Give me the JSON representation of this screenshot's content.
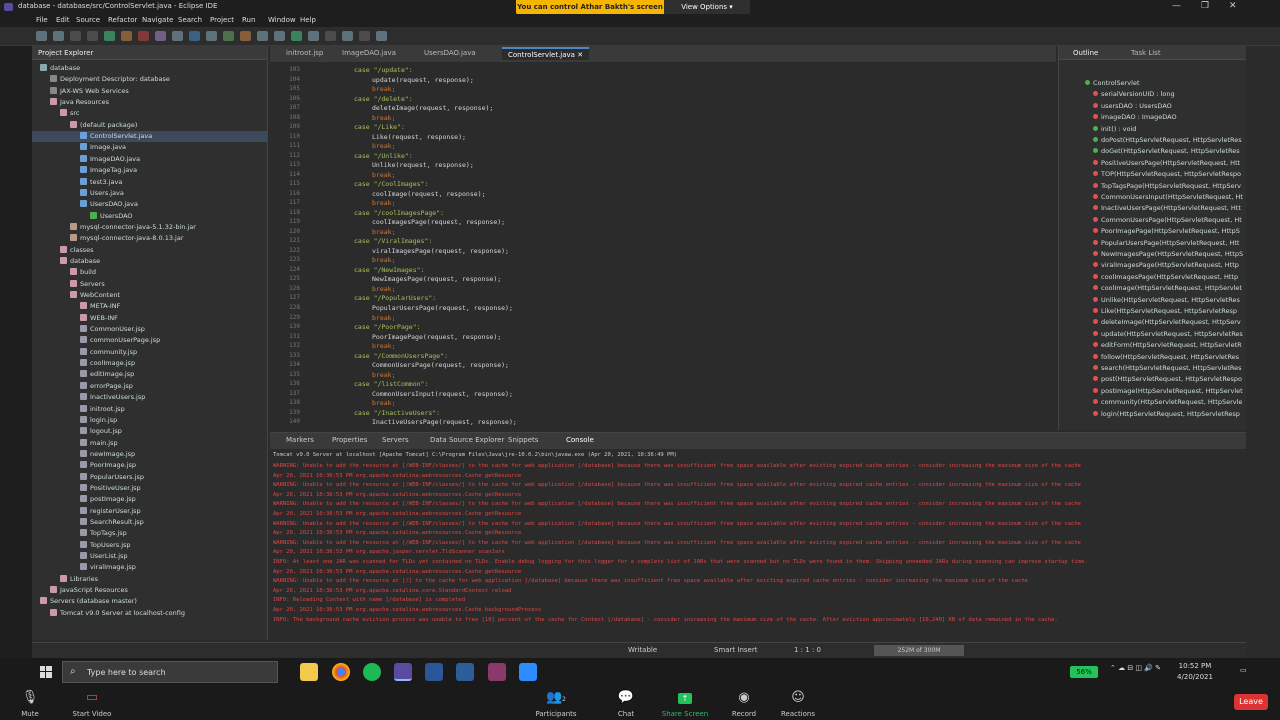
{
  "window": {
    "title": "database - database/src/ControlServlet.java - Eclipse IDE"
  },
  "share_banner": {
    "text": "You can control Athar Bakth's screen",
    "view_options": "View Options"
  },
  "menu": [
    "File",
    "Edit",
    "Source",
    "Refactor",
    "Navigate",
    "Search",
    "Project",
    "Run",
    "Window",
    "Help"
  ],
  "explorer": {
    "title": "Project Explorer",
    "tree": [
      {
        "label": "database",
        "indent": 0,
        "color": "#8aa"
      },
      {
        "label": "Deployment Descriptor: database",
        "indent": 1,
        "color": "#888"
      },
      {
        "label": "JAX-WS Web Services",
        "indent": 1,
        "color": "#888"
      },
      {
        "label": "Java Resources",
        "indent": 1,
        "color": "#c9a"
      },
      {
        "label": "src",
        "indent": 2,
        "color": "#c9a"
      },
      {
        "label": "(default package)",
        "indent": 3,
        "color": "#c9a"
      },
      {
        "label": "ControlServlet.java",
        "indent": 4,
        "color": "#6a9fd8",
        "selected": true
      },
      {
        "label": "Image.java",
        "indent": 4,
        "color": "#6a9fd8"
      },
      {
        "label": "ImageDAO.java",
        "indent": 4,
        "color": "#6a9fd8"
      },
      {
        "label": "ImageTag.java",
        "indent": 4,
        "color": "#6a9fd8"
      },
      {
        "label": "test3.java",
        "indent": 4,
        "color": "#6a9fd8"
      },
      {
        "label": "Users.java",
        "indent": 4,
        "color": "#6a9fd8"
      },
      {
        "label": "UsersDAO.java",
        "indent": 4,
        "color": "#6a9fd8"
      },
      {
        "label": "UsersDAO",
        "indent": 5,
        "color": "#4caf50"
      },
      {
        "label": "mysql-connector-java-5.1.32-bin.jar",
        "indent": 3,
        "color": "#b98"
      },
      {
        "label": "mysql-connector-java-8.0.13.jar",
        "indent": 3,
        "color": "#b98"
      },
      {
        "label": "classes",
        "indent": 2,
        "color": "#c9a"
      },
      {
        "label": "database",
        "indent": 2,
        "color": "#c9a"
      },
      {
        "label": "build",
        "indent": 3,
        "color": "#c9a"
      },
      {
        "label": "Servers",
        "indent": 3,
        "color": "#c9a"
      },
      {
        "label": "WebContent",
        "indent": 3,
        "color": "#c9a"
      },
      {
        "label": "META-INF",
        "indent": 4,
        "color": "#c9a"
      },
      {
        "label": "WEB-INF",
        "indent": 4,
        "color": "#c9a"
      },
      {
        "label": "CommonUser.jsp",
        "indent": 4,
        "color": "#99a"
      },
      {
        "label": "commonUserPage.jsp",
        "indent": 4,
        "color": "#99a"
      },
      {
        "label": "community.jsp",
        "indent": 4,
        "color": "#99a"
      },
      {
        "label": "coolImage.jsp",
        "indent": 4,
        "color": "#99a"
      },
      {
        "label": "editImage.jsp",
        "indent": 4,
        "color": "#99a"
      },
      {
        "label": "errorPage.jsp",
        "indent": 4,
        "color": "#99a"
      },
      {
        "label": "InactiveUsers.jsp",
        "indent": 4,
        "color": "#99a"
      },
      {
        "label": "initroot.jsp",
        "indent": 4,
        "color": "#99a"
      },
      {
        "label": "login.jsp",
        "indent": 4,
        "color": "#99a"
      },
      {
        "label": "logout.jsp",
        "indent": 4,
        "color": "#99a"
      },
      {
        "label": "main.jsp",
        "indent": 4,
        "color": "#99a"
      },
      {
        "label": "newImage.jsp",
        "indent": 4,
        "color": "#99a"
      },
      {
        "label": "PoorImage.jsp",
        "indent": 4,
        "color": "#99a"
      },
      {
        "label": "PopularUsers.jsp",
        "indent": 4,
        "color": "#99a"
      },
      {
        "label": "PositiveUser.jsp",
        "indent": 4,
        "color": "#99a"
      },
      {
        "label": "postImage.jsp",
        "indent": 4,
        "color": "#99a"
      },
      {
        "label": "registerUser.jsp",
        "indent": 4,
        "color": "#99a"
      },
      {
        "label": "SearchResult.jsp",
        "indent": 4,
        "color": "#99a"
      },
      {
        "label": "TopTags.jsp",
        "indent": 4,
        "color": "#99a"
      },
      {
        "label": "TopUsers.jsp",
        "indent": 4,
        "color": "#99a"
      },
      {
        "label": "UserList.jsp",
        "indent": 4,
        "color": "#99a"
      },
      {
        "label": "viralImage.jsp",
        "indent": 4,
        "color": "#99a"
      },
      {
        "label": "Libraries",
        "indent": 2,
        "color": "#c9a"
      },
      {
        "label": "JavaScript Resources",
        "indent": 1,
        "color": "#c9a"
      },
      {
        "label": "Servers (database master)",
        "indent": 0,
        "color": "#c9a"
      },
      {
        "label": "Tomcat v9.0 Server at localhost-config",
        "indent": 1,
        "color": "#c9a"
      }
    ]
  },
  "editor": {
    "tabs": [
      {
        "label": "initroot.jsp",
        "active": false
      },
      {
        "label": "ImageDAO.java",
        "active": false
      },
      {
        "label": "UsersDAO.java",
        "active": false
      },
      {
        "label": "ControlServlet.java",
        "active": true
      }
    ],
    "lines": [
      {
        "no": "103",
        "text": "case \"/update\":",
        "indent": 1,
        "type": "case"
      },
      {
        "no": "104",
        "text": "update(request, response);",
        "indent": 2,
        "type": "call"
      },
      {
        "no": "105",
        "text": "break;",
        "indent": 2,
        "type": "kw"
      },
      {
        "no": "106",
        "text": "case \"/delete\":",
        "indent": 1,
        "type": "case"
      },
      {
        "no": "107",
        "text": "deleteImage(request, response);",
        "indent": 2,
        "type": "call"
      },
      {
        "no": "108",
        "text": "break;",
        "indent": 2,
        "type": "kw"
      },
      {
        "no": "109",
        "text": "case \"/Like\":",
        "indent": 1,
        "type": "case"
      },
      {
        "no": "110",
        "text": "Like(request, response);",
        "indent": 2,
        "type": "call"
      },
      {
        "no": "111",
        "text": "break;",
        "indent": 2,
        "type": "kw"
      },
      {
        "no": "112",
        "text": "case \"/Unlike\":",
        "indent": 1,
        "type": "case"
      },
      {
        "no": "113",
        "text": "Unlike(request, response);",
        "indent": 2,
        "type": "call"
      },
      {
        "no": "114",
        "text": "break;",
        "indent": 2,
        "type": "kw"
      },
      {
        "no": "115",
        "text": "case \"/CoolImages\":",
        "indent": 1,
        "type": "case"
      },
      {
        "no": "116",
        "text": "coolImage(request, response);",
        "indent": 2,
        "type": "call"
      },
      {
        "no": "117",
        "text": "break;",
        "indent": 2,
        "type": "kw"
      },
      {
        "no": "118",
        "text": "case \"/coolImagesPage\":",
        "indent": 1,
        "type": "case"
      },
      {
        "no": "119",
        "text": "coolImagesPage(request, response);",
        "indent": 2,
        "type": "call"
      },
      {
        "no": "120",
        "text": "break;",
        "indent": 2,
        "type": "kw"
      },
      {
        "no": "121",
        "text": "case \"/ViralImages\":",
        "indent": 1,
        "type": "case"
      },
      {
        "no": "122",
        "text": "viralImagesPage(request, response);",
        "indent": 2,
        "type": "call"
      },
      {
        "no": "123",
        "text": "break;",
        "indent": 2,
        "type": "kw"
      },
      {
        "no": "124",
        "text": "case \"/NewImages\":",
        "indent": 1,
        "type": "case"
      },
      {
        "no": "125",
        "text": "NewImagesPage(request, response);",
        "indent": 2,
        "type": "call"
      },
      {
        "no": "126",
        "text": "break;",
        "indent": 2,
        "type": "kw"
      },
      {
        "no": "127",
        "text": "case \"/PopularUsers\":",
        "indent": 1,
        "type": "case"
      },
      {
        "no": "128",
        "text": "PopularUsersPage(request, response);",
        "indent": 2,
        "type": "call"
      },
      {
        "no": "129",
        "text": "break;",
        "indent": 2,
        "type": "kw"
      },
      {
        "no": "130",
        "text": "case \"/PoorPage\":",
        "indent": 1,
        "type": "case"
      },
      {
        "no": "131",
        "text": "PoorImagePage(request, response);",
        "indent": 2,
        "type": "call"
      },
      {
        "no": "132",
        "text": "break;",
        "indent": 2,
        "type": "kw"
      },
      {
        "no": "133",
        "text": "case \"/CommonUsersPage\":",
        "indent": 1,
        "type": "case"
      },
      {
        "no": "134",
        "text": "CommonUsersPage(request, response);",
        "indent": 2,
        "type": "call"
      },
      {
        "no": "135",
        "text": "break;",
        "indent": 2,
        "type": "kw"
      },
      {
        "no": "136",
        "text": "case \"/listCommon\":",
        "indent": 1,
        "type": "case"
      },
      {
        "no": "137",
        "text": "CommonUsersInput(request, response);",
        "indent": 2,
        "type": "call"
      },
      {
        "no": "138",
        "text": "break;",
        "indent": 2,
        "type": "kw"
      },
      {
        "no": "139",
        "text": "case \"/InactiveUsers\":",
        "indent": 1,
        "type": "case"
      },
      {
        "no": "140",
        "text": "InactiveUsersPage(request, response);",
        "indent": 2,
        "type": "call"
      }
    ]
  },
  "outline": {
    "tabs": [
      "Outline",
      "Task List"
    ],
    "items": [
      {
        "label": "ControlServlet",
        "color": "#4caf50"
      },
      {
        "label": "serialVersionUID : long",
        "color": "#e05050"
      },
      {
        "label": "usersDAO : UsersDAO",
        "color": "#e05050"
      },
      {
        "label": "imageDAO : ImageDAO",
        "color": "#e05050"
      },
      {
        "label": "init() : void",
        "color": "#4caf50"
      },
      {
        "label": "doPost(HttpServletRequest, HttpServletRes",
        "color": "#4caf50"
      },
      {
        "label": "doGet(HttpServletRequest, HttpServletRes",
        "color": "#4caf50"
      },
      {
        "label": "PositiveUsersPage(HttpServletRequest, Htt",
        "color": "#e05050"
      },
      {
        "label": "TOP(HttpServletRequest, HttpServletRespo",
        "color": "#e05050"
      },
      {
        "label": "TopTagsPage(HttpServletRequest, HttpServ",
        "color": "#e05050"
      },
      {
        "label": "CommonUsersInput(HttpServletRequest, Ht",
        "color": "#e05050"
      },
      {
        "label": "InactiveUsersPage(HttpServletRequest, Htt",
        "color": "#e05050"
      },
      {
        "label": "CommonUsersPage(HttpServletRequest, Ht",
        "color": "#e05050"
      },
      {
        "label": "PoorImagePage(HttpServletRequest, HttpS",
        "color": "#e05050"
      },
      {
        "label": "PopularUsersPage(HttpServletRequest, Htt",
        "color": "#e05050"
      },
      {
        "label": "NewImagesPage(HttpServletRequest, HttpS",
        "color": "#e05050"
      },
      {
        "label": "viralImagesPage(HttpServletRequest, Http",
        "color": "#e05050"
      },
      {
        "label": "coolImagesPage(HttpServletRequest, Http",
        "color": "#e05050"
      },
      {
        "label": "coolImage(HttpServletRequest, HttpServlet",
        "color": "#e05050"
      },
      {
        "label": "Unlike(HttpServletRequest, HttpServletRes",
        "color": "#e05050"
      },
      {
        "label": "Like(HttpServletRequest, HttpServletResp",
        "color": "#e05050"
      },
      {
        "label": "deleteImage(HttpServletRequest, HttpServ",
        "color": "#e05050"
      },
      {
        "label": "update(HttpServletRequest, HttpServletRes",
        "color": "#e05050"
      },
      {
        "label": "editForm(HttpServletRequest, HttpServletR",
        "color": "#e05050"
      },
      {
        "label": "follow(HttpServletRequest, HttpServletRes",
        "color": "#e05050"
      },
      {
        "label": "search(HttpServletRequest, HttpServletRes",
        "color": "#e05050"
      },
      {
        "label": "post(HttpServletRequest, HttpServletRespo",
        "color": "#e05050"
      },
      {
        "label": "postImage(HttpServletRequest, HttpServlet",
        "color": "#e05050"
      },
      {
        "label": "community(HttpServletRequest, HttpServle",
        "color": "#e05050"
      },
      {
        "label": "login(HttpServletRequest, HttpServletResp",
        "color": "#e05050"
      }
    ]
  },
  "console": {
    "tabs": [
      "Markers",
      "Properties",
      "Servers",
      "Data Source Explorer",
      "Snippets",
      "Console"
    ],
    "header": "Tomcat v9.0 Server at localhost [Apache Tomcat] C:\\Program Files\\Java\\jre-10.0.2\\bin\\javaw.exe (Apr 20, 2021, 10:36:49 PM)",
    "lines": [
      "WARNING: Unable to add the resource at [/WEB-INF/classes/] to the cache for web application [/database] because there was insufficient free space available after evicting expired cache entries - consider increasing the maximum size of the cache",
      "Apr 20, 2021 10:36:53 PM org.apache.catalina.webresources.Cache getResource",
      "WARNING: Unable to add the resource at [/WEB-INF/classes/] to the cache for web application [/database] because there was insufficient free space available after evicting expired cache entries - consider increasing the maximum size of the cache",
      "Apr 20, 2021 10:36:53 PM org.apache.catalina.webresources.Cache getResource",
      "WARNING: Unable to add the resource at [/WEB-INF/classes/] to the cache for web application [/database] because there was insufficient free space available after evicting expired cache entries - consider increasing the maximum size of the cache",
      "Apr 20, 2021 10:36:53 PM org.apache.catalina.webresources.Cache getResource",
      "WARNING: Unable to add the resource at [/WEB-INF/classes/] to the cache for web application [/database] because there was insufficient free space available after evicting expired cache entries - consider increasing the maximum size of the cache",
      "Apr 20, 2021 10:36:53 PM org.apache.catalina.webresources.Cache getResource",
      "WARNING: Unable to add the resource at [/WEB-INF/classes/] to the cache for web application [/database] because there was insufficient free space available after evicting expired cache entries - consider increasing the maximum size of the cache",
      "Apr 20, 2021 10:36:53 PM org.apache.jasper.servlet.TldScanner scanJars",
      "INFO: At least one JAR was scanned for TLDs yet contained no TLDs. Enable debug logging for this logger for a complete list of JARs that were scanned but no TLDs were found in them. Skipping unneeded JARs during scanning can improve startup time.",
      "Apr 20, 2021 10:36:53 PM org.apache.catalina.webresources.Cache getResource",
      "WARNING: Unable to add the resource at [/] to the cache for web application [/database] because there was insufficient free space available after evicting expired cache entries - consider increasing the maximum size of the cache",
      "Apr 20, 2021 10:36:53 PM org.apache.catalina.core.StandardContext reload",
      "INFO: Reloading Context with name [/database] is completed",
      "Apr 20, 2021 10:36:53 PM org.apache.catalina.webresources.Cache backgroundProcess",
      "INFO: The background cache eviction process was unable to free [10] percent of the cache for Context [/database] - consider increasing the maximum size of the cache. After eviction approximately [10,240] KB of data remained in the cache."
    ]
  },
  "status": {
    "writable": "Writable",
    "insert": "Smart Insert",
    "position": "1 : 1 : 0",
    "heap": "252M of 300M"
  },
  "taskbar": {
    "search_placeholder": "Type here to search",
    "battery": "56%",
    "time": "10:52 PM",
    "date": "4/20/2021"
  },
  "zoom": {
    "mute": "Mute",
    "video": "Start Video",
    "participants": "Participants",
    "participants_count": "2",
    "chat": "Chat",
    "share": "Share Screen",
    "record": "Record",
    "reactions": "Reactions",
    "leave": "Leave"
  },
  "colors": {
    "accent": "#4a88c7",
    "error": "#e04545",
    "share_green": "#24c25d",
    "banner": "#f6b500"
  }
}
